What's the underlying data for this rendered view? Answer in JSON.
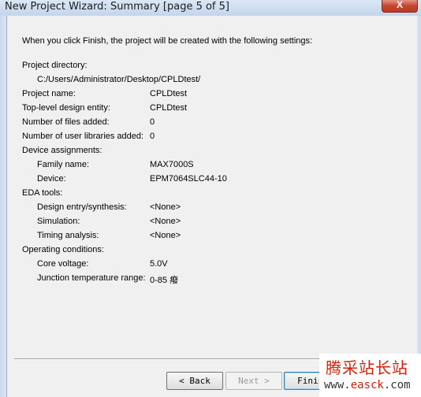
{
  "window": {
    "title": "New Project Wizard: Summary [page 5 of 5]",
    "close_glyph": "X"
  },
  "intro": "When you click Finish, the project will be created with the following settings:",
  "settings": {
    "project_directory_label": "Project directory:",
    "project_directory_value": "C:/Users/Administrator/Desktop/CPLDtest/",
    "project_name_label": "Project name:",
    "project_name_value": "CPLDtest",
    "top_level_label": "Top-level design entity:",
    "top_level_value": "CPLDtest",
    "files_added_label": "Number of files added:",
    "files_added_value": "0",
    "user_libraries_label": "Number of user libraries added:",
    "user_libraries_value": "0",
    "device_assignments_label": "Device assignments:",
    "family_name_label": "Family name:",
    "family_name_value": "MAX7000S",
    "device_label": "Device:",
    "device_value": "EPM7064SLC44-10",
    "eda_tools_label": "EDA tools:",
    "design_entry_label": "Design entry/synthesis:",
    "design_entry_value": "<None>",
    "simulation_label": "Simulation:",
    "simulation_value": "<None>",
    "timing_label": "Timing analysis:",
    "timing_value": "<None>",
    "operating_conditions_label": "Operating conditions:",
    "core_voltage_label": "Core voltage:",
    "core_voltage_value": "5.0V",
    "junction_temp_label": "Junction temperature range:",
    "junction_temp_value": "0-85 癈"
  },
  "buttons": {
    "back": "< Back",
    "next": "Next >",
    "finish": "Finish"
  },
  "watermark": {
    "chinese": "腾采站长站",
    "url_prefix": "www.",
    "url_brand": "easck",
    "url_suffix": ".com"
  },
  "colors": {
    "titlebar": "#c3d5ea",
    "client": "#f0f0f0",
    "close": "#c7452e",
    "watermark_red": "#d81e06"
  }
}
